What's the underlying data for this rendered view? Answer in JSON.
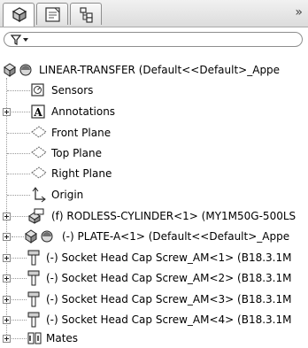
{
  "toolbar": {
    "overflow_glyph": "»",
    "tabs": [
      {
        "name": "featuremanager-tab"
      },
      {
        "name": "propertymanager-tab"
      },
      {
        "name": "configurationmanager-tab"
      }
    ]
  },
  "filter": {
    "icon": "filter-icon"
  },
  "tree": {
    "root": {
      "label": "LINEAR-TRANSFER  (Default<<Default>_Appe"
    },
    "items": [
      {
        "label": "Sensors",
        "icon": "sensors-icon",
        "expandable": false
      },
      {
        "label": "Annotations",
        "icon": "annotations-icon",
        "expandable": true
      },
      {
        "label": "Front Plane",
        "icon": "plane-icon",
        "expandable": false
      },
      {
        "label": "Top Plane",
        "icon": "plane-icon",
        "expandable": false
      },
      {
        "label": "Right Plane",
        "icon": "plane-icon",
        "expandable": false
      },
      {
        "label": "Origin",
        "icon": "origin-icon",
        "expandable": false
      },
      {
        "label": "(f) RODLESS-CYLINDER<1> (MY1M50G-500LS",
        "icon": "subassembly-icon",
        "expandable": true
      },
      {
        "label": "(-) PLATE-A<1> (Default<<Default>_Appe",
        "icon": "part-icon",
        "expandable": true
      },
      {
        "label": "(-) Socket Head Cap Screw_AM<1> (B18.3.1M",
        "icon": "screw-icon",
        "expandable": true
      },
      {
        "label": "(-) Socket Head Cap Screw_AM<2> (B18.3.1M",
        "icon": "screw-icon",
        "expandable": true
      },
      {
        "label": "(-) Socket Head Cap Screw_AM<3> (B18.3.1M",
        "icon": "screw-icon",
        "expandable": true
      },
      {
        "label": "(-) Socket Head Cap Screw_AM<4> (B18.3.1M",
        "icon": "screw-icon",
        "expandable": true
      },
      {
        "label": "Mates",
        "icon": "mates-icon",
        "expandable": true
      }
    ]
  }
}
